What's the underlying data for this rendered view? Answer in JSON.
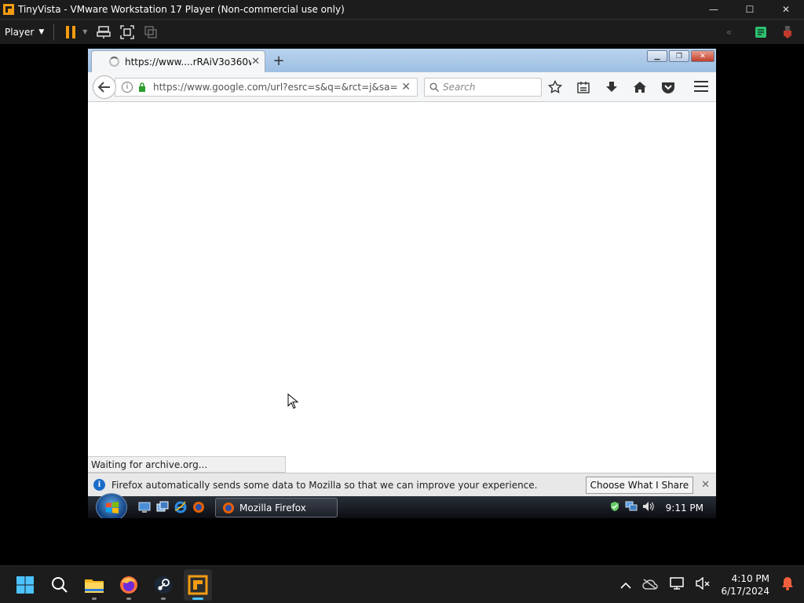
{
  "vmware": {
    "title": "TinyVista - VMware Workstation 17 Player (Non-commercial use only)",
    "player_menu_label": "Player",
    "accent": "#f39c12"
  },
  "firefox": {
    "tab_title": "https://www....rRAiV3o360w",
    "url": "https://www.google.com/url?esrc=s&q=&rct=j&sa=",
    "search_placeholder": "Search",
    "status_text": "Waiting for archive.org...",
    "notification_text": "Firefox automatically sends some data to Mozilla so that we can improve your experience.",
    "notification_button": "Choose What I Share"
  },
  "vista_taskbar": {
    "task_label": "Mozilla Firefox",
    "clock": "9:11 PM"
  },
  "windows_taskbar": {
    "time": "4:10 PM",
    "date": "6/17/2024",
    "apps": [
      "start-icon",
      "search-icon",
      "file-explorer-icon",
      "firefox-icon",
      "steam-icon",
      "vmware-icon"
    ]
  }
}
